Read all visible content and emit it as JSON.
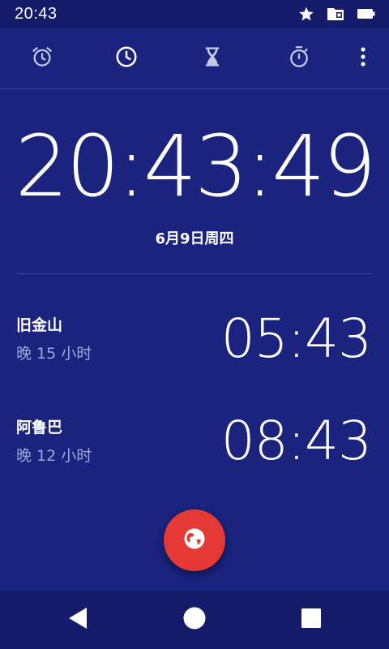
{
  "status_bar": {
    "time": "20:43",
    "icons": [
      "star-icon",
      "sd-card-icon",
      "battery-icon"
    ]
  },
  "tabs": [
    {
      "name": "tab-alarm",
      "icon": "alarm-icon",
      "selected": false
    },
    {
      "name": "tab-clock",
      "icon": "clock-icon",
      "selected": true
    },
    {
      "name": "tab-timer",
      "icon": "hourglass-icon",
      "selected": false
    },
    {
      "name": "tab-stopwatch",
      "icon": "stopwatch-icon",
      "selected": false
    }
  ],
  "overflow_menu_icon": "more-vert-icon",
  "clock": {
    "time": "20:43:49",
    "date": "6月9日周四"
  },
  "world_clocks": [
    {
      "city": "旧金山",
      "offset": "晚 15 小时",
      "time": "05:43"
    },
    {
      "city": "阿鲁巴",
      "offset": "晚 12 小时",
      "time": "08:43"
    }
  ],
  "fab": {
    "icon": "globe-icon"
  },
  "nav_bar": {
    "buttons": [
      "back-icon",
      "home-icon",
      "recents-icon"
    ]
  },
  "colors": {
    "background": "#1a237e",
    "bars": "#141b68",
    "accent_fab": "#e53935",
    "secondary_text": "#9fa8da",
    "icon_inactive": "#c5cae9"
  }
}
